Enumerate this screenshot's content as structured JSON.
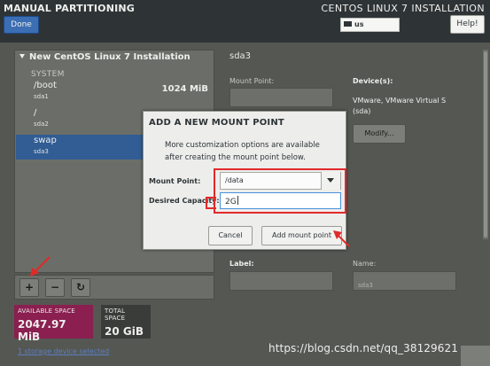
{
  "header": {
    "title": "MANUAL PARTITIONING",
    "product": "CENTOS LINUX 7 INSTALLATION",
    "done_label": "Done",
    "keyboard_layout": "us",
    "help_label": "Help!"
  },
  "partitions": {
    "header": "New CentOS Linux 7 Installation",
    "system_label": "SYSTEM",
    "mounts": [
      {
        "name": "/boot",
        "device": "sda1",
        "size": "1024 MiB"
      },
      {
        "name": "/",
        "device": "sda2",
        "size": ""
      },
      {
        "name": "swap",
        "device": "sda3",
        "size": "",
        "selected": true
      }
    ],
    "toolbar": {
      "add": "+",
      "remove": "−",
      "refresh": "↻"
    }
  },
  "space": {
    "available_label": "AVAILABLE SPACE",
    "available_value": "2047.97 MiB",
    "total_label": "TOTAL SPACE",
    "total_value": "20 GiB"
  },
  "storage_link": "1 storage device selected",
  "details": {
    "title": "sda3",
    "mount_point_label": "Mount Point:",
    "desired_capacity_label": "Desired Capacity:",
    "devices_label": "Device(s):",
    "devices_value": "VMware, VMware Virtual S (sda)",
    "modify_label": "Modify...",
    "label_label": "Label:",
    "name_label": "Name:",
    "name_value": "sda3"
  },
  "dialog": {
    "title": "ADD A NEW MOUNT POINT",
    "description": "More customization options are available after creating the mount point below.",
    "mount_point_label": "Mount Point:",
    "mount_point_value": "/data",
    "capacity_label": "Desired Capacity:",
    "capacity_value": "2G",
    "cancel_label": "Cancel",
    "add_label": "Add mount point"
  },
  "watermark": "https://blog.csdn.net/qq_38129621",
  "colors": {
    "accent": "#3c6eb4",
    "available_space": "#8a1f50",
    "annotation": "#e02a2a"
  }
}
